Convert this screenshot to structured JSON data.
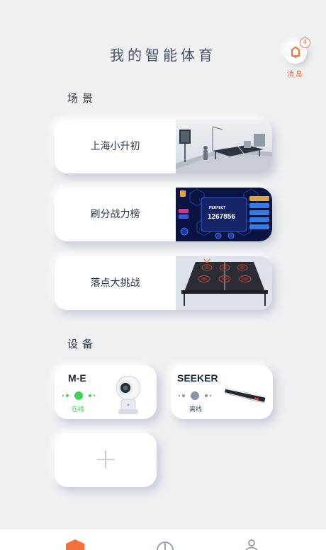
{
  "header": {
    "title": "我的智能体育",
    "messages": {
      "label": "消息",
      "badge": "4",
      "icon": "bell-icon"
    }
  },
  "sections": {
    "scenes": "场景",
    "devices": "设备"
  },
  "scenes": [
    {
      "label": "上海小升初",
      "image": "table-tennis-training-room"
    },
    {
      "label": "刷分战力榜",
      "image": "score-leaderboard-screen",
      "image_text": {
        "perfect": "PERFECT",
        "score": "1267856"
      }
    },
    {
      "label": "落点大挑战",
      "image": "table-landing-target"
    }
  ],
  "devices": [
    {
      "name": "M-E",
      "status": "在线",
      "status_color": "#3fd35a",
      "image": "camera-robot"
    },
    {
      "name": "SEEKER",
      "status": "离线",
      "status_color": "#8a93a3",
      "image": "sensor-bar"
    }
  ],
  "add_device": {
    "label": "+"
  },
  "tabbar": {
    "accent": "#f2703a",
    "tabs": [
      "home-icon",
      "sports-icon",
      "profile-icon"
    ]
  }
}
